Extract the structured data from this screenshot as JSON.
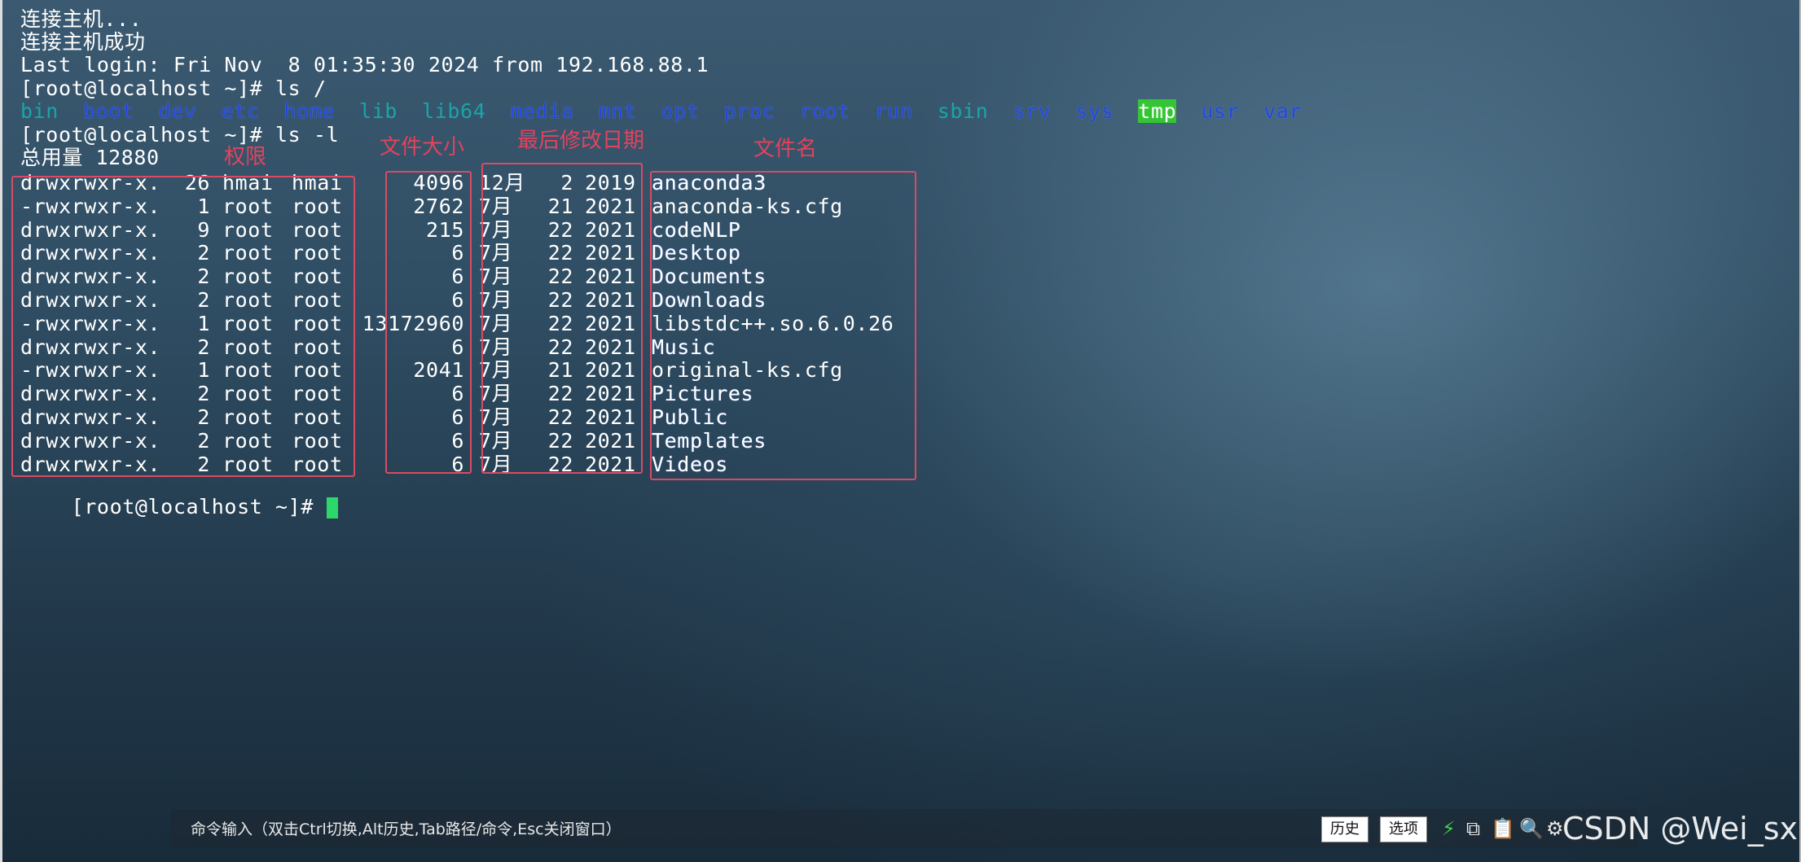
{
  "terminal": {
    "lines": [
      "连接主机...",
      "连接主机成功",
      "Last login: Fri Nov  8 01:35:30 2024 from 192.168.88.1",
      "[root@localhost ~]# ls /"
    ],
    "ls_root": [
      {
        "name": "bin",
        "color": "cyan"
      },
      {
        "name": "boot",
        "color": "blue"
      },
      {
        "name": "dev",
        "color": "blue"
      },
      {
        "name": "etc",
        "color": "blue"
      },
      {
        "name": "home",
        "color": "blue"
      },
      {
        "name": "lib",
        "color": "cyan"
      },
      {
        "name": "lib64",
        "color": "cyan"
      },
      {
        "name": "media",
        "color": "blue"
      },
      {
        "name": "mnt",
        "color": "blue"
      },
      {
        "name": "opt",
        "color": "blue"
      },
      {
        "name": "proc",
        "color": "blue"
      },
      {
        "name": "root",
        "color": "blue"
      },
      {
        "name": "run",
        "color": "blue"
      },
      {
        "name": "sbin",
        "color": "cyan"
      },
      {
        "name": "srv",
        "color": "blue"
      },
      {
        "name": "sys",
        "color": "blue"
      },
      {
        "name": "tmp",
        "color": "tmp"
      },
      {
        "name": "usr",
        "color": "blue"
      },
      {
        "name": "var",
        "color": "blue"
      }
    ],
    "ls_l_command": "[root@localhost ~]# ls -l",
    "total": "总用量 12880",
    "entries": [
      {
        "perm": "drwxrwxr-x.",
        "links": "26",
        "owner": "hmai",
        "group": "hmai",
        "size": "4096",
        "month": "12月",
        "day": "2",
        "year": "2019",
        "name": "anaconda3",
        "color": "blue"
      },
      {
        "perm": "-rwxrwxr-x.",
        "links": "1",
        "owner": "root",
        "group": "root",
        "size": "2762",
        "month": "7月",
        "day": "21",
        "year": "2021",
        "name": "anaconda-ks.cfg",
        "color": "green"
      },
      {
        "perm": "drwxrwxr-x.",
        "links": "9",
        "owner": "root",
        "group": "root",
        "size": "215",
        "month": "7月",
        "day": "22",
        "year": "2021",
        "name": "codeNLP",
        "color": "blue"
      },
      {
        "perm": "drwxrwxr-x.",
        "links": "2",
        "owner": "root",
        "group": "root",
        "size": "6",
        "month": "7月",
        "day": "22",
        "year": "2021",
        "name": "Desktop",
        "color": "blue"
      },
      {
        "perm": "drwxrwxr-x.",
        "links": "2",
        "owner": "root",
        "group": "root",
        "size": "6",
        "month": "7月",
        "day": "22",
        "year": "2021",
        "name": "Documents",
        "color": "blue"
      },
      {
        "perm": "drwxrwxr-x.",
        "links": "2",
        "owner": "root",
        "group": "root",
        "size": "6",
        "month": "7月",
        "day": "22",
        "year": "2021",
        "name": "Downloads",
        "color": "blue"
      },
      {
        "perm": "-rwxrwxr-x.",
        "links": "1",
        "owner": "root",
        "group": "root",
        "size": "13172960",
        "month": "7月",
        "day": "22",
        "year": "2021",
        "name": "libstdc++.so.6.0.26",
        "color": "green"
      },
      {
        "perm": "drwxrwxr-x.",
        "links": "2",
        "owner": "root",
        "group": "root",
        "size": "6",
        "month": "7月",
        "day": "22",
        "year": "2021",
        "name": "Music",
        "color": "blue"
      },
      {
        "perm": "-rwxrwxr-x.",
        "links": "1",
        "owner": "root",
        "group": "root",
        "size": "2041",
        "month": "7月",
        "day": "21",
        "year": "2021",
        "name": "original-ks.cfg",
        "color": "green"
      },
      {
        "perm": "drwxrwxr-x.",
        "links": "2",
        "owner": "root",
        "group": "root",
        "size": "6",
        "month": "7月",
        "day": "22",
        "year": "2021",
        "name": "Pictures",
        "color": "blue"
      },
      {
        "perm": "drwxrwxr-x.",
        "links": "2",
        "owner": "root",
        "group": "root",
        "size": "6",
        "month": "7月",
        "day": "22",
        "year": "2021",
        "name": "Public",
        "color": "blue"
      },
      {
        "perm": "drwxrwxr-x.",
        "links": "2",
        "owner": "root",
        "group": "root",
        "size": "6",
        "month": "7月",
        "day": "22",
        "year": "2021",
        "name": "Templates",
        "color": "blue"
      },
      {
        "perm": "drwxrwxr-x.",
        "links": "2",
        "owner": "root",
        "group": "root",
        "size": "6",
        "month": "7月",
        "day": "22",
        "year": "2021",
        "name": "Videos",
        "color": "blue"
      }
    ],
    "final_prompt": "[root@localhost ~]# "
  },
  "annotations": {
    "permissions": "权限",
    "file_size": "文件大小",
    "modified_date": "最后修改日期",
    "file_name": "文件名"
  },
  "command_bar": {
    "hint": "命令输入（双击Ctrl切换,Alt历史,Tab路径/命令,Esc关闭窗口）",
    "history_button": "历史",
    "options_button": "选项"
  },
  "watermark": "CSDN @Wei_sx",
  "colors": {
    "dir_blue": "#2347d8",
    "exec_green": "#39d53b",
    "link_cyan": "#19a5a8",
    "annotation_red": "#e2435d",
    "cursor_green": "#2bd86a"
  }
}
